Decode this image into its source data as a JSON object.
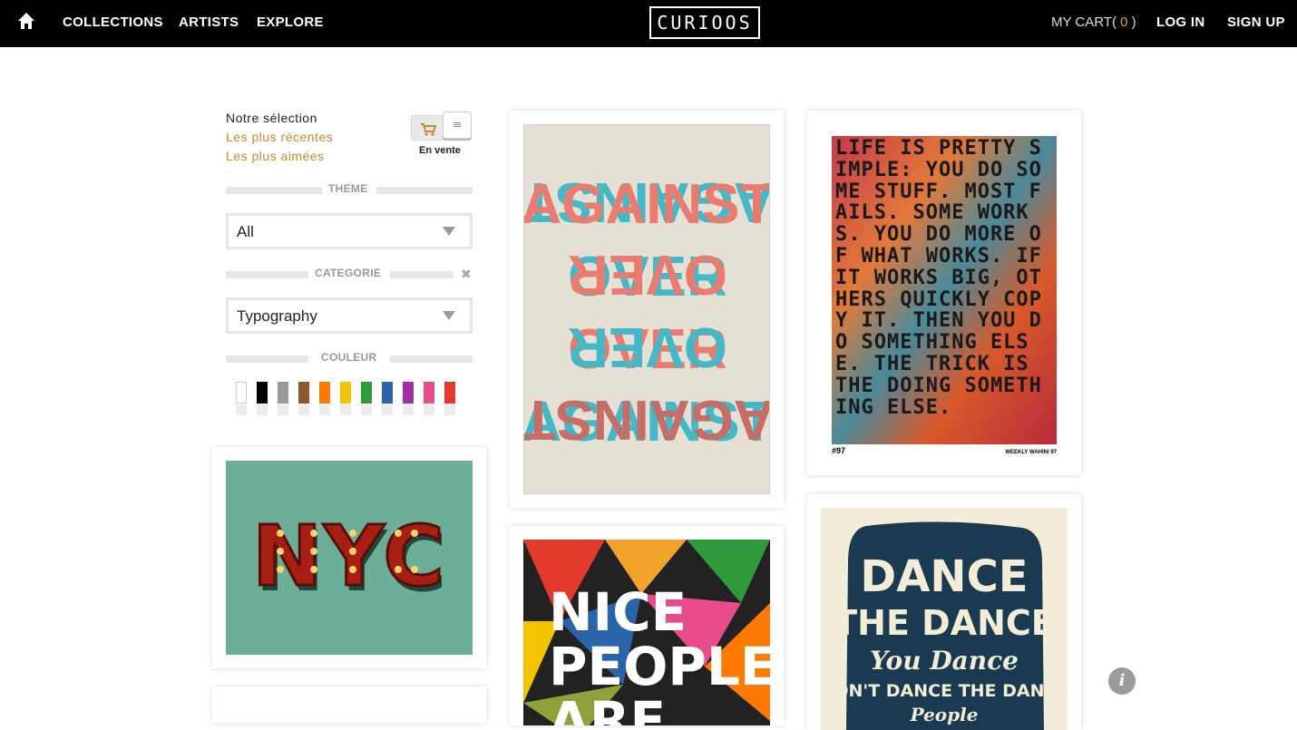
{
  "nav": {
    "home_icon": "home-icon",
    "links": [
      "COLLECTIONS",
      "ARTISTS",
      "EXPLORE"
    ],
    "logo": "CURIOOS",
    "cart_label": "MY CART",
    "cart_open": "(",
    "cart_count": "0",
    "cart_close": ")",
    "login": "LOG IN",
    "signup": "SIGN UP"
  },
  "sidebar": {
    "sort_options": [
      "Notre sélection",
      "Les plus récentes",
      "Les plus aimées"
    ],
    "toggle_cart_icon": "cart-icon",
    "toggle_list_icon": "list-icon",
    "toggle_caption": "En vente",
    "theme": {
      "label": "THEME",
      "value": "All"
    },
    "categorie": {
      "label": "CATEGORIE",
      "value": "Typography",
      "clear_icon": "close-icon"
    },
    "couleur": {
      "label": "COULEUR",
      "swatches": [
        "#ffffff",
        "#000000",
        "#999999",
        "#8b5a2b",
        "#ff7a00",
        "#f5c400",
        "#2e9a3c",
        "#2a63a8",
        "#9c32a8",
        "#e84c8b",
        "#e23a2c"
      ]
    }
  },
  "posters": {
    "nyc": {
      "text": "NYC"
    },
    "against_over": {
      "lines": [
        "AGAINST",
        "OVER",
        "OVER",
        "AGAINST"
      ]
    },
    "life_is_pretty": {
      "text": "LIFE IS PRETTY SIMPLE: YOU DO SOME STUFF. MOST FAILS. SOME WORKS. YOU DO MORE OF WHAT WORKS. IF IT WORKS BIG, OTHERS QUICKLY COPY IT. THEN YOU DO SOMETHING ELSE. THE TRICK IS THE DOING SOMETHING ELSE.",
      "footer_left": "#97",
      "footer_right": "WEEKLY WAHINI 97"
    },
    "nice_people": {
      "lines": [
        "NICE",
        "PEOPLE",
        "ARE"
      ]
    },
    "dance": {
      "lines": [
        "DANCE",
        "THE DANCE",
        "You Dance",
        "DON'T DANCE THE DANCE",
        "People"
      ]
    }
  },
  "info_icon": "info-icon"
}
